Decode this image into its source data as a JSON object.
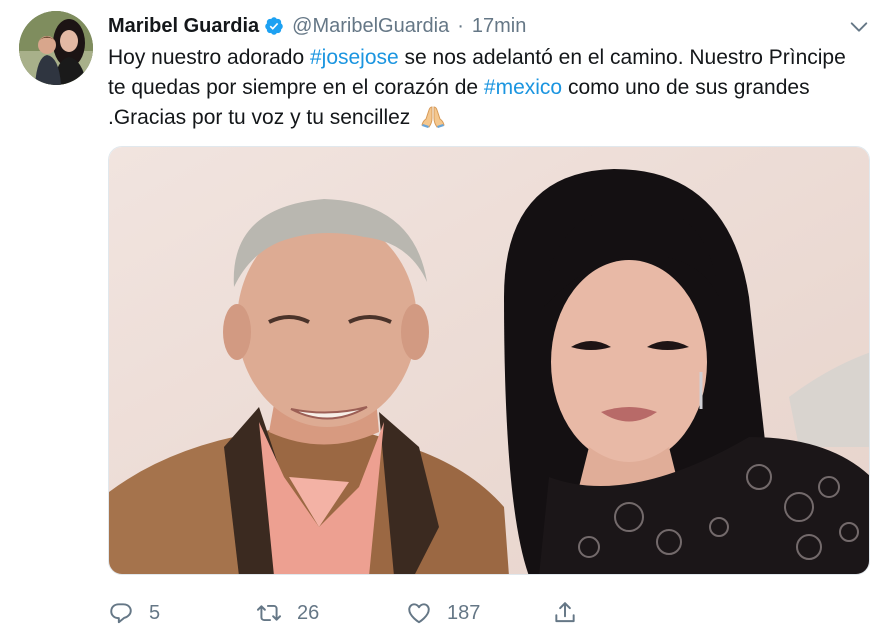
{
  "tweet": {
    "display_name": "Maribel Guardia",
    "handle": "@MaribelGuardia",
    "separator": "·",
    "time": "17min",
    "verified": true,
    "text_parts": {
      "p1": "Hoy nuestro adorado ",
      "tag1": "#josejose",
      "p2": " se nos adelantó en el camino. Nuestro Prìncipe te quedas por siempre en el corazón de ",
      "tag2": "#mexico",
      "p3": " como uno de sus grandes .Gracias por tu voz y tu sencillez "
    },
    "emoji": "folded-hands-emoji",
    "accent_color": "#1b95e0",
    "muted_color": "#657786"
  },
  "actions": {
    "replies": "5",
    "retweets": "26",
    "likes": "187"
  },
  "icons": {
    "verified": "verified-badge-icon",
    "caret": "chevron-down-icon",
    "reply": "reply-icon",
    "retweet": "retweet-icon",
    "like": "heart-icon",
    "share": "share-icon"
  }
}
